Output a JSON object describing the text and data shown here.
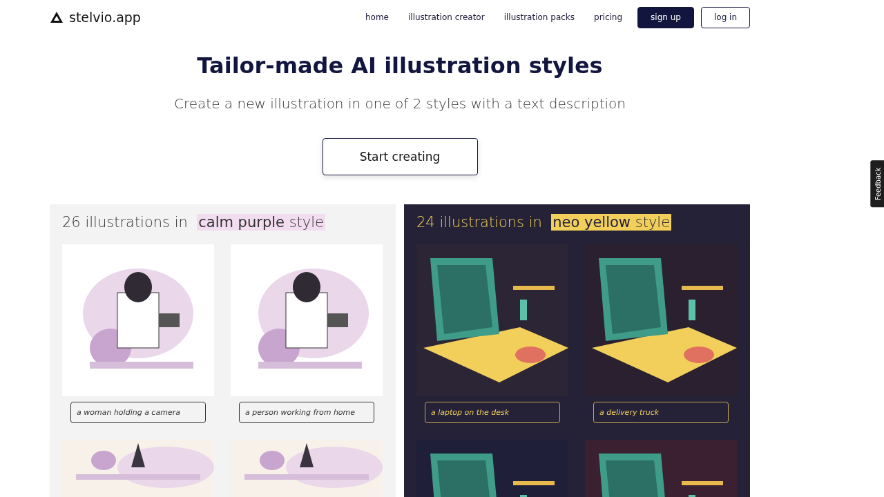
{
  "brand": {
    "name": "stelvio.app"
  },
  "nav": {
    "links": [
      "home",
      "illustration creator",
      "illustration packs",
      "pricing"
    ],
    "buttons": [
      {
        "label": "sign up",
        "kind": "primary"
      },
      {
        "label": "log in",
        "kind": "outline"
      }
    ]
  },
  "hero": {
    "title": "Tailor-made AI illustration styles",
    "subtitle": "Create a new illustration in one of 2 styles with a text description",
    "button": "Start creating"
  },
  "styles": [
    {
      "count_text": "26 illustrations in",
      "style_name": "calm purple",
      "style_word": "style",
      "kind": "light",
      "items": [
        {
          "kind": "picture",
          "caption": "a woman holding a camera"
        },
        {
          "kind": "picture",
          "caption": "a person working from home"
        },
        {
          "kind": "picture"
        },
        {
          "kind": "picture"
        }
      ]
    },
    {
      "count_text": "24 illustrations in",
      "style_name": "neo yellow",
      "style_word": "style",
      "kind": "dark",
      "items": [
        {
          "kind": "picture",
          "caption": "a laptop on the desk"
        },
        {
          "kind": "picture",
          "caption": "a delivery truck"
        },
        {
          "kind": "picture"
        },
        {
          "kind": "picture"
        }
      ]
    }
  ],
  "feedback_tab": "Feedback"
}
